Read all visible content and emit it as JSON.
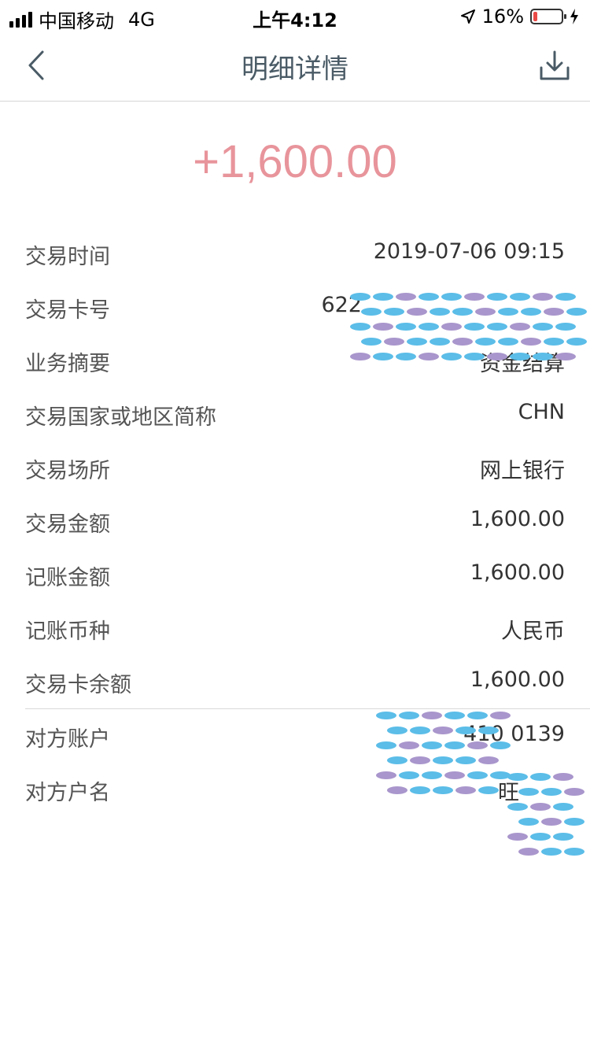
{
  "status_bar": {
    "carrier": "中国移动",
    "network": "4G",
    "time": "上午4:12",
    "battery_percent": "16%",
    "battery_level": 0.16,
    "battery_color": "#e94a47"
  },
  "nav": {
    "title": "明细详情",
    "back_icon": "chevron-left-icon",
    "download_icon": "download-icon"
  },
  "amount": "+1,600.00",
  "amount_color": "#e8949b",
  "details": [
    {
      "label": "交易时间",
      "value": "2019-07-06 09:15"
    },
    {
      "label": "交易卡号",
      "value": "622"
    },
    {
      "label": "业务摘要",
      "value": "资金结算"
    },
    {
      "label": "交易国家或地区简称",
      "value": "CHN"
    },
    {
      "label": "交易场所",
      "value": "网上银行"
    },
    {
      "label": "交易金额",
      "value": "1,600.00"
    },
    {
      "label": "记账金额",
      "value": "1,600.00"
    },
    {
      "label": "记账币种",
      "value": "人民币"
    },
    {
      "label": "交易卡余额",
      "value": "1,600.00"
    }
  ],
  "counterparty": [
    {
      "label": "对方账户",
      "value": "410 0139"
    },
    {
      "label": "对方户名",
      "value": "旺"
    }
  ]
}
